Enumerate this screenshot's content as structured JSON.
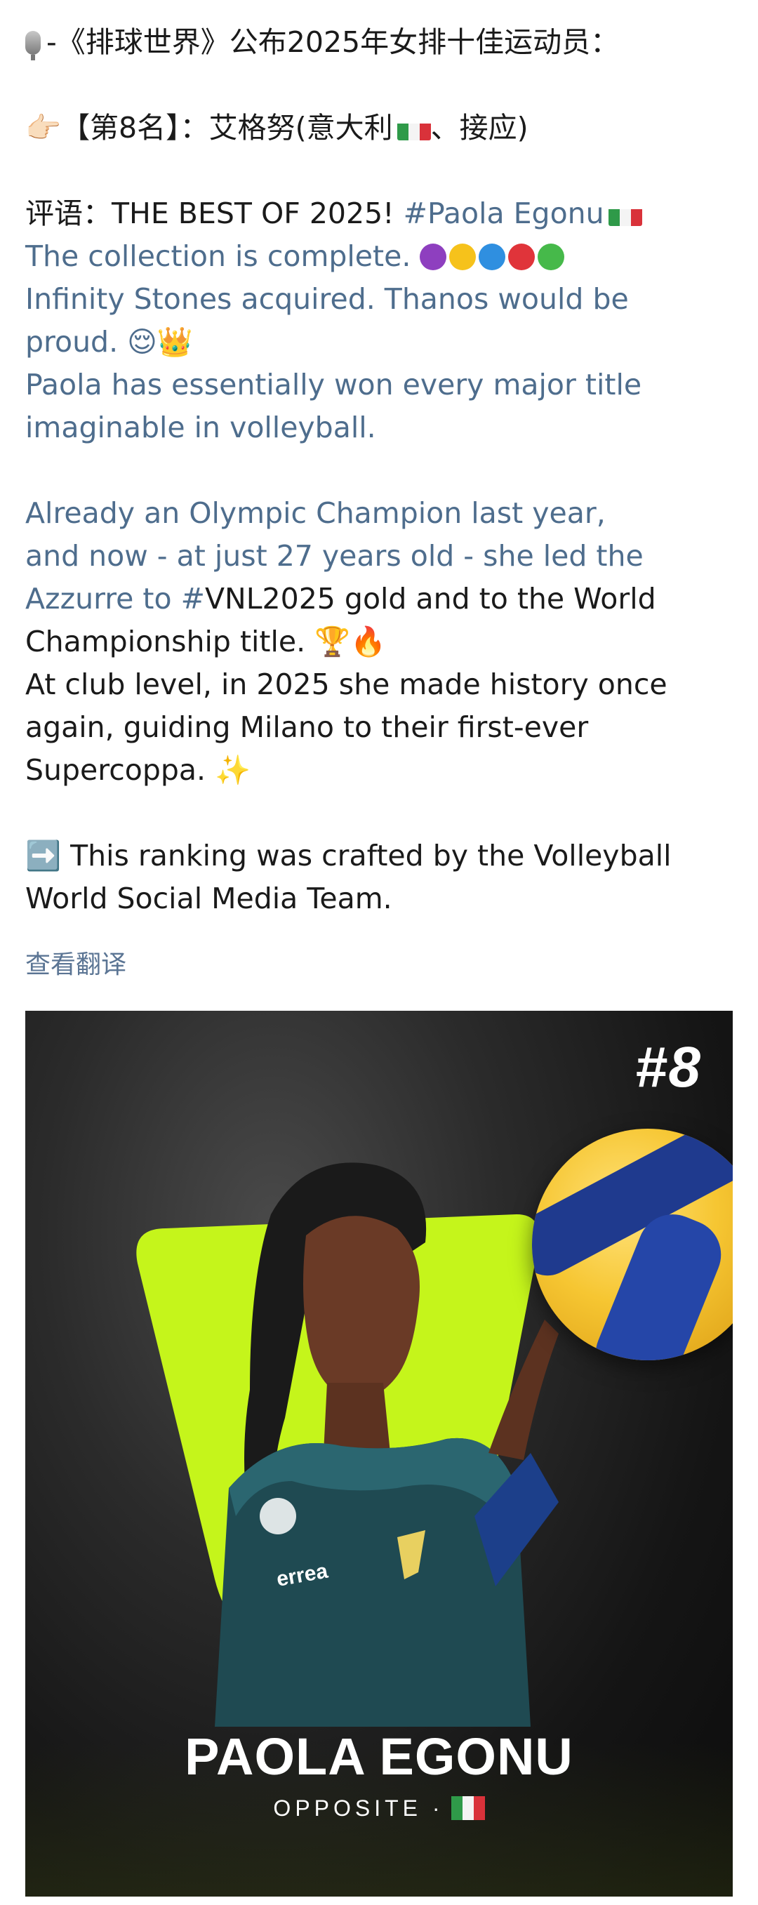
{
  "post": {
    "title_line": "-《排球世界》公布2025年女排十佳运动员：",
    "rank_line_prefix": "【第8名】：艾格努(意大利",
    "rank_line_suffix": "、接应)",
    "comment_prefix": "评语：THE BEST OF 2025!  ",
    "hashtag_name": "#Paola Egonu",
    "line3": "The collection is complete.",
    "line4": "Infinity Stones acquired. Thanos would be",
    "line5": "proud.",
    "line6": "Paola has essentially won every major title",
    "line7": "imaginable in volleyball.",
    "line8": "Already an Olympic Champion last year,",
    "line9": "and now - at just 27 years old - she led the",
    "line10_blue": "Azzurre to #",
    "line10_dark": "VNL2025 gold and to the World",
    "line11": "Championship title.",
    "line12": "At club level, in 2025 she made history once",
    "line13": "again, guiding Milano to their first-ever",
    "line14": "Supercoppa.",
    "line15": "This ranking was crafted by the Volleyball",
    "line16": "World Social Media Team.",
    "translate_link": "查看翻译"
  },
  "emoji": {
    "pointing_hand": "👉🏻",
    "relieved_face": "😌",
    "crown": "👑",
    "trophy": "🏆",
    "fire": "🔥",
    "sparkles": "✨",
    "right_arrow": "➡️"
  },
  "stones_colors": [
    "#8e3fbf",
    "#f6c21b",
    "#2f8fe0",
    "#e0343a",
    "#46b94a"
  ],
  "card": {
    "rank": "#8",
    "player_name": "PAOLA EGONU",
    "position": "OPPOSITE  ·",
    "shield_color": "#c5f51b"
  }
}
